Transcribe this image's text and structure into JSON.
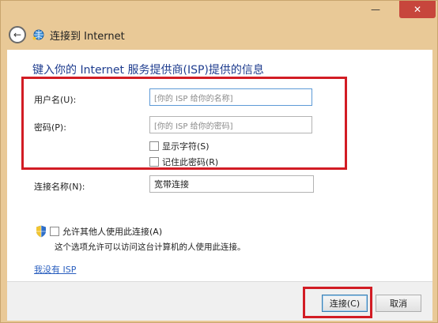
{
  "window": {
    "title": "连接到 Internet",
    "min_glyph": "—",
    "close_glyph": "✕"
  },
  "heading": "键入你的 Internet 服务提供商(ISP)提供的信息",
  "form": {
    "username_label": "用户名(U):",
    "username_placeholder": "[你的 ISP 给你的名称]",
    "password_label": "密码(P):",
    "password_placeholder": "[你的 ISP 给你的密码]",
    "show_chars_label": "显示字符(S)",
    "remember_label": "记住此密码(R)",
    "conn_name_label": "连接名称(N):",
    "conn_name_value": "宽带连接",
    "allow_others_label": "允许其他人使用此连接(A)",
    "allow_note": "这个选项允许可以访问这台计算机的人使用此连接。",
    "no_isp_link": "我没有 ISP"
  },
  "buttons": {
    "connect": "连接(C)",
    "cancel": "取消"
  },
  "colors": {
    "accent_red": "#d21c24",
    "heading_blue": "#1f3d8f",
    "link_blue": "#2a5fbf",
    "frame": "#e9c997"
  }
}
